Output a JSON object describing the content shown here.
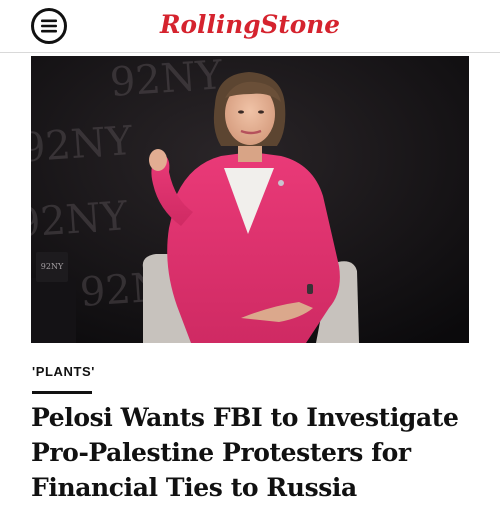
{
  "header": {
    "menu_icon": "hamburger-menu-icon",
    "logo_text": "RollingStone",
    "brand_color": "#d5232e"
  },
  "hero_image": {
    "backdrop_text": "92NY",
    "sign_text": "92NY",
    "jacket_color": "#e1306c"
  },
  "article": {
    "kicker": "'PLANTS'",
    "headline": "Pelosi Wants FBI to Investigate Pro-Palestine Protesters for Financial Ties to Russia"
  }
}
